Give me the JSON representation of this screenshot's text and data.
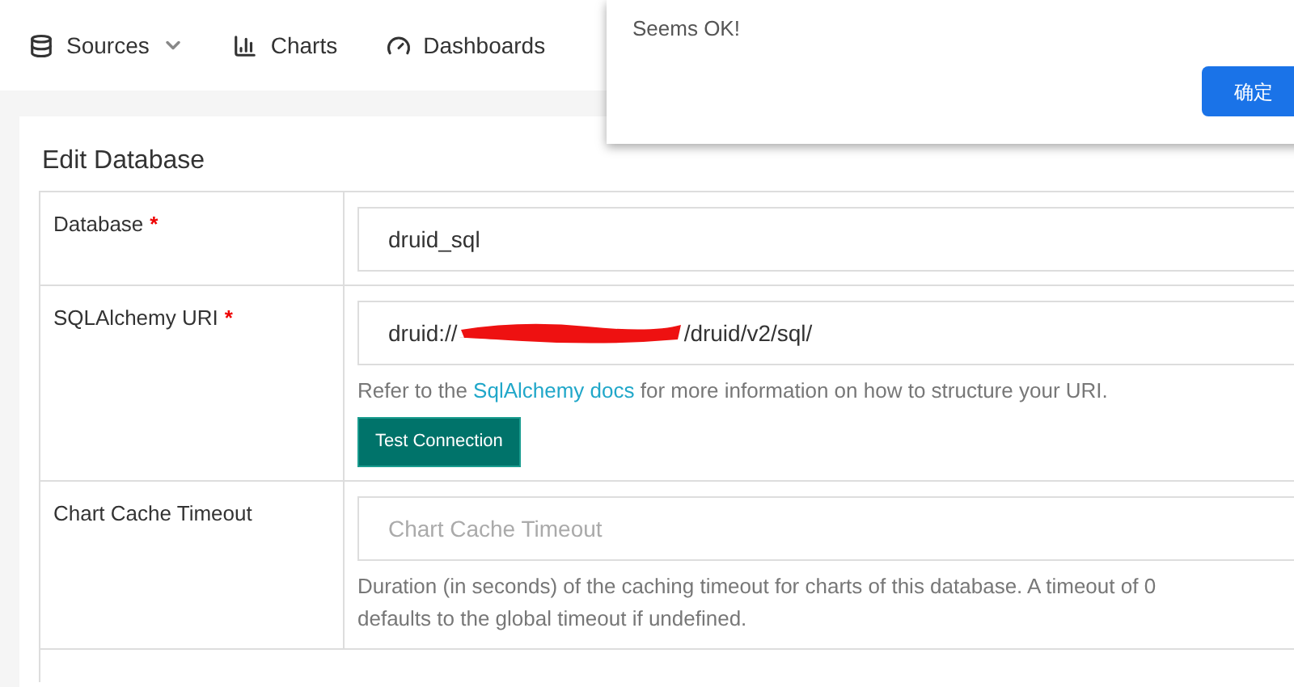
{
  "nav": [
    {
      "label": "Sources",
      "dropdown": true
    },
    {
      "label": "Charts",
      "dropdown": false
    },
    {
      "label": "Dashboards",
      "dropdown": false
    }
  ],
  "panel": {
    "title": "Edit Database"
  },
  "rows": [
    {
      "label": "Database",
      "required_mark": "*",
      "field": {
        "value": "druid_sql"
      }
    },
    {
      "label": "SQLAlchemy URI",
      "required_mark": "*",
      "field": {
        "value_start": "druid://",
        "redacted": true,
        "value_end": "/druid/v2/sql/"
      },
      "help": {
        "before": "Refer to the ",
        "link": "SqlAlchemy docs",
        "after": " for more information on how to structure your URI."
      },
      "button": "Test Connection"
    },
    {
      "label": "Chart Cache Timeout",
      "field": {
        "placeholder": "Chart Cache Timeout"
      },
      "help_lines": [
        "Duration (in seconds) of the caching timeout for charts of this database. A timeout of 0",
        "defaults to the global timeout if undefined."
      ]
    }
  ],
  "dialog": {
    "message": "Seems OK!",
    "button": "确定"
  }
}
